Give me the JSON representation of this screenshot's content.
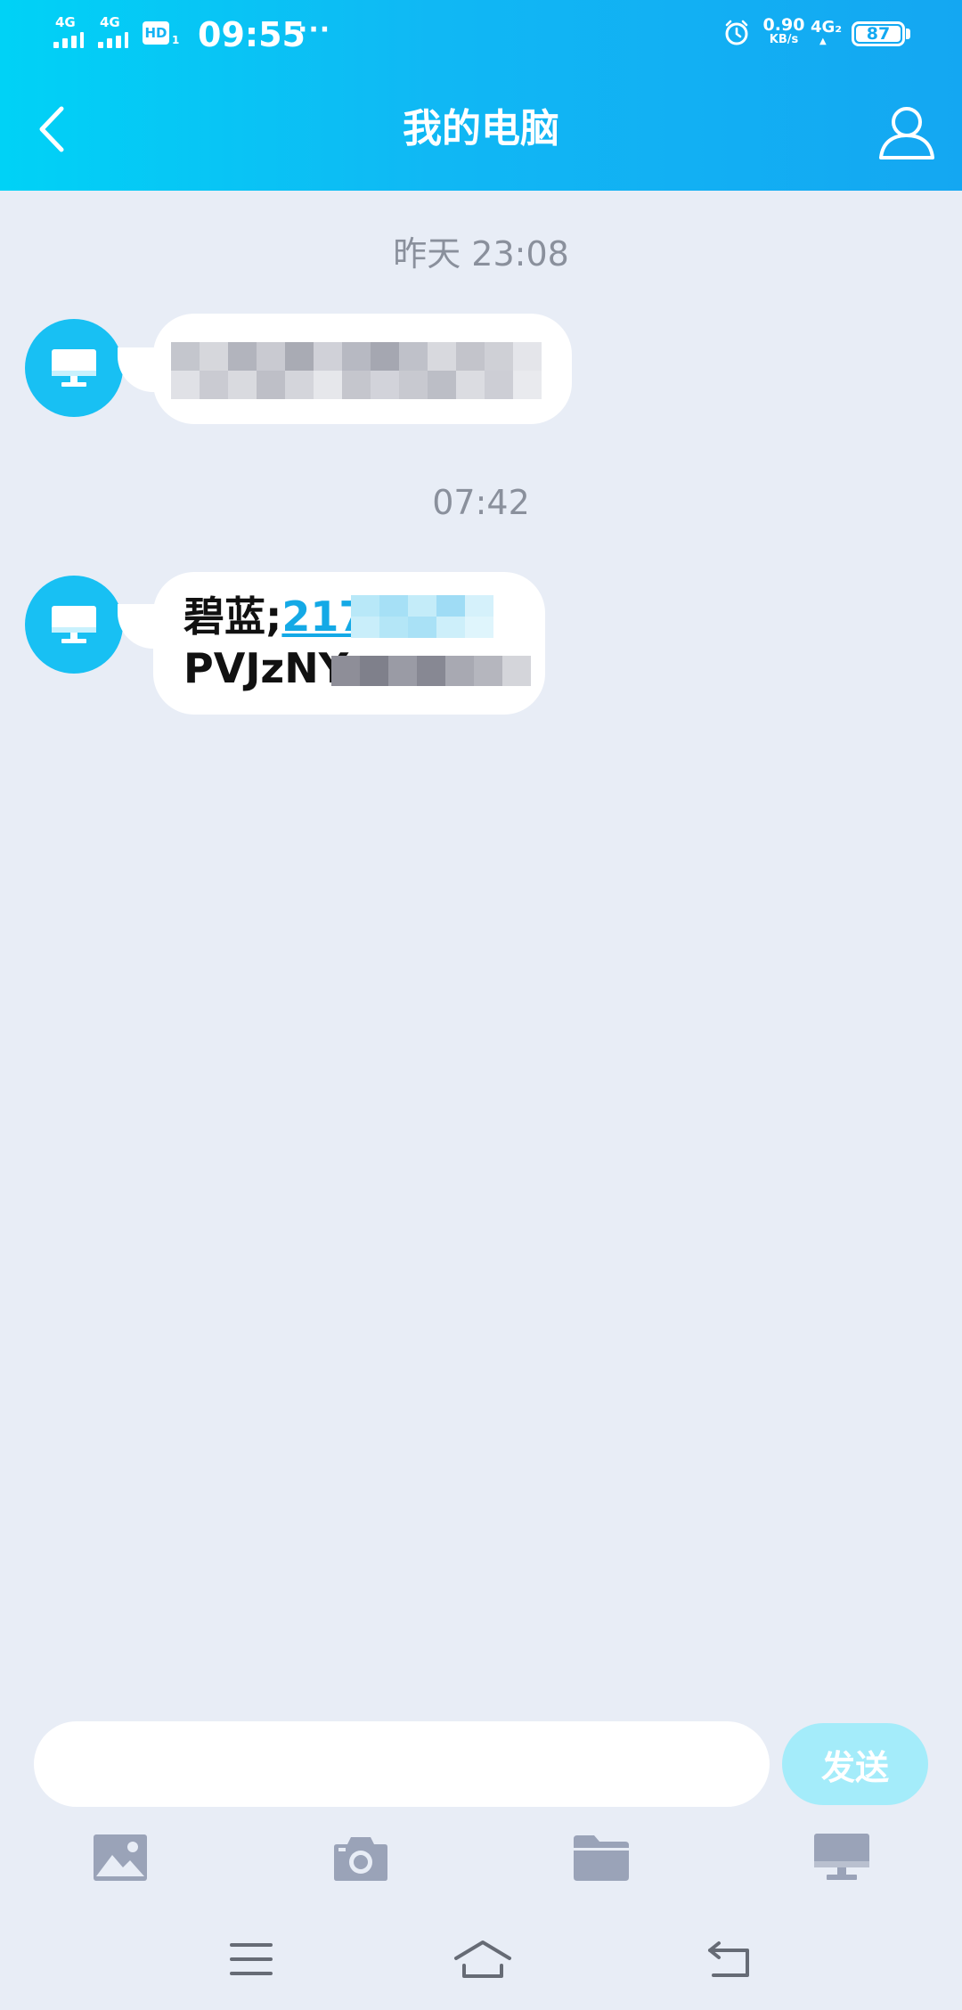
{
  "status_bar": {
    "sim1_network": "4G",
    "sim2_network": "4G",
    "hd_label": "HD",
    "hd_sub": "1",
    "time": "09:55",
    "more_dots": "···",
    "speed_value": "0.90",
    "speed_unit": "KB/s",
    "network_4g": "4G₂",
    "battery_level": "87"
  },
  "title_bar": {
    "title": "我的电脑"
  },
  "chat": {
    "messages": [
      {
        "timestamp": "昨天 23:08",
        "sender_icon": "monitor-icon",
        "content_redacted": true
      },
      {
        "timestamp": "07:42",
        "sender_icon": "monitor-icon",
        "line1_prefix": "碧蓝;",
        "line1_link": "217",
        "line2": "PVJzNY"
      }
    ]
  },
  "input_bar": {
    "placeholder": "",
    "send_label": "发送"
  },
  "toolbar": {
    "items": [
      "image-icon",
      "camera-icon",
      "folder-icon",
      "computer-icon"
    ]
  },
  "nav_bar": {
    "items": [
      "menu-icon",
      "home-icon",
      "back-icon"
    ]
  },
  "colors": {
    "header_start": "#00d2f6",
    "header_end": "#14a7f2",
    "background": "#e8edf6",
    "avatar": "#18c0f3",
    "link": "#14a9e6",
    "send_button": "#a4ecfa",
    "toolbar_icon": "#9aa3b8"
  }
}
